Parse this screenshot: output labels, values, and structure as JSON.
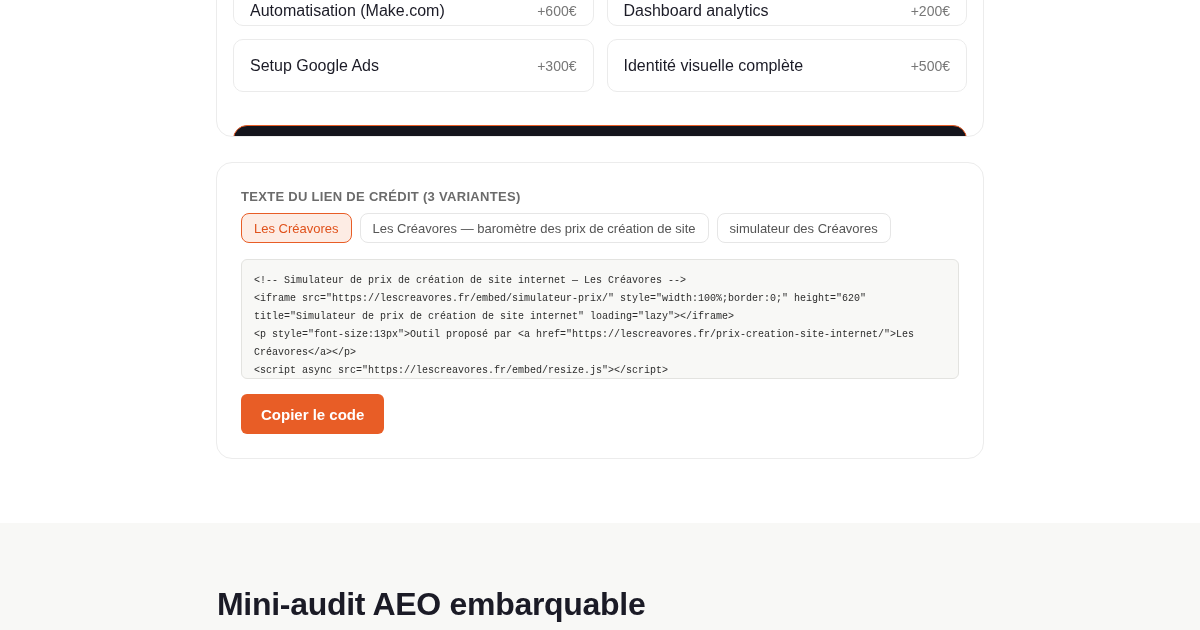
{
  "options_panel": {
    "options": [
      {
        "label": "Automatisation (Make.com)",
        "price": "+600€"
      },
      {
        "label": "Dashboard analytics",
        "price": "+200€"
      },
      {
        "label": "Setup Google Ads",
        "price": "+300€"
      },
      {
        "label": "Identité visuelle complète",
        "price": "+500€"
      }
    ]
  },
  "embed_card": {
    "title": "TEXTE DU LIEN DE CRÉDIT (3 VARIANTES)",
    "variants": [
      {
        "label": "Les Créavores",
        "selected": true
      },
      {
        "label": "Les Créavores — baromètre des prix de création de site",
        "selected": false
      },
      {
        "label": "simulateur des Créavores",
        "selected": false
      }
    ],
    "code": "<!-- Simulateur de prix de création de site internet — Les Créavores -->\n<iframe src=\"https://lescreavores.fr/embed/simulateur-prix/\" style=\"width:100%;border:0;\" height=\"620\" title=\"Simulateur de prix de création de site internet\" loading=\"lazy\"></iframe>\n<p style=\"font-size:13px\">Outil proposé par <a href=\"https://lescreavores.fr/prix-creation-site-internet/\">Les Créavores</a></p>\n<script async src=\"https://lescreavores.fr/embed/resize.js\"></script>",
    "copy_button": "Copier le code"
  },
  "next_section": {
    "heading": "Mini-audit AEO embarquable"
  }
}
